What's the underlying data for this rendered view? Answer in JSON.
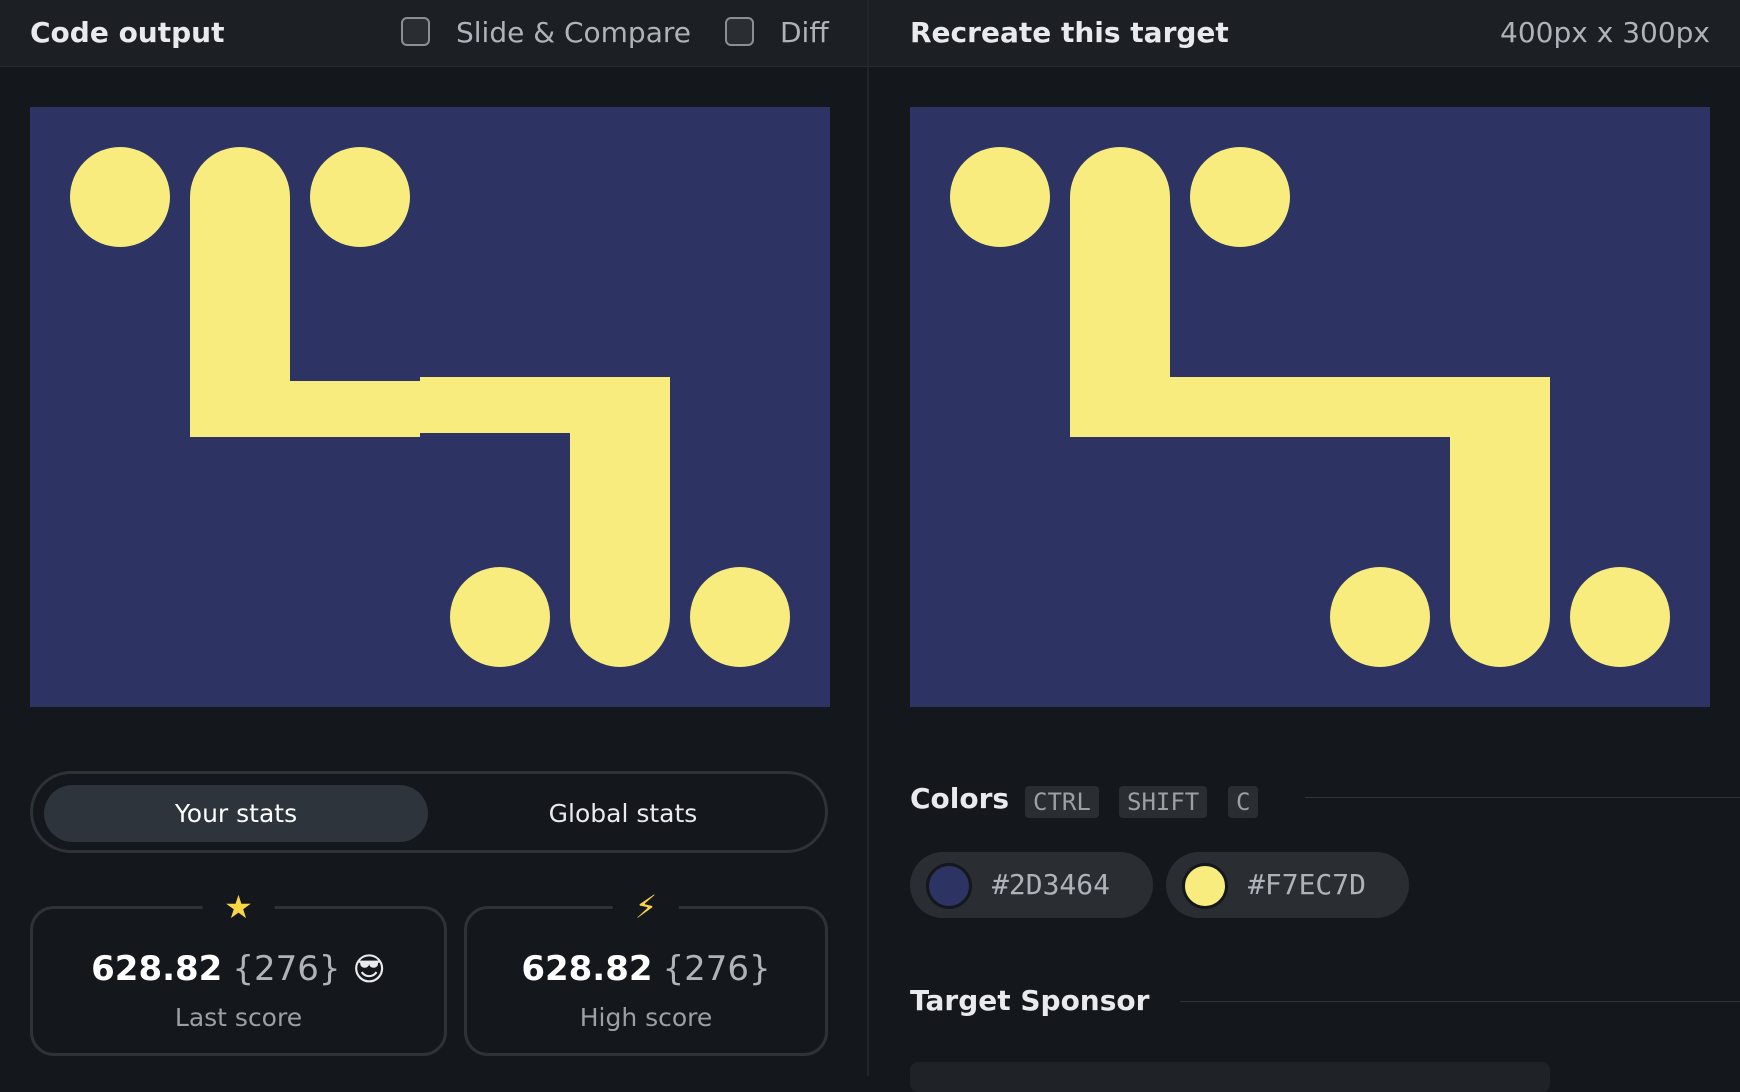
{
  "left_panel": {
    "title": "Code output",
    "slide_compare_label": "Slide & Compare",
    "diff_label": "Diff",
    "stats_tabs": [
      "Your stats",
      "Global stats"
    ],
    "last_score": {
      "value": "628.82",
      "count": "{276}",
      "emoji": "😎",
      "label": "Last score"
    },
    "high_score": {
      "value": "628.82",
      "count": "{276}",
      "label": "High score"
    },
    "star_icon": "★",
    "bolt_icon": "⚡"
  },
  "right_panel": {
    "title": "Recreate this target",
    "dimensions": "400px x 300px",
    "colors_title": "Colors",
    "shortcut_keys": [
      "CTRL",
      "SHIFT",
      "C"
    ],
    "colors": [
      {
        "hex": "#2D3464"
      },
      {
        "hex": "#F7EC7D"
      }
    ],
    "sponsor_title": "Target Sponsor"
  },
  "theme": {
    "canvas_bg": "#2D3464",
    "shape_color": "#F7EC7D"
  }
}
